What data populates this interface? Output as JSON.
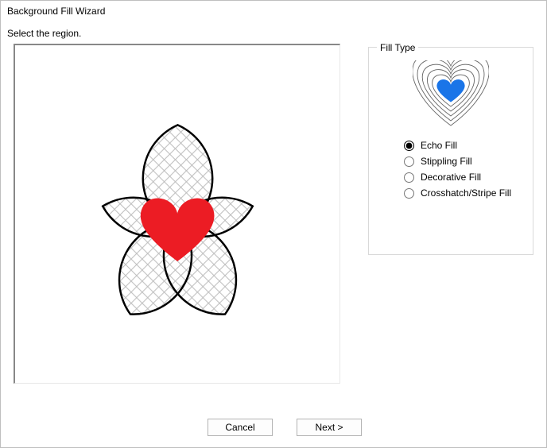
{
  "window": {
    "title": "Background Fill Wizard",
    "instruction": "Select the region."
  },
  "fill_type": {
    "legend": "Fill Type",
    "selected": "echo",
    "options": [
      {
        "id": "echo",
        "label": "Echo Fill"
      },
      {
        "id": "stippling",
        "label": "Stippling Fill"
      },
      {
        "id": "decorative",
        "label": "Decorative Fill"
      },
      {
        "id": "crosshatch",
        "label": "Crosshatch/Stripe Fill"
      }
    ]
  },
  "buttons": {
    "cancel": "Cancel",
    "next": "Next >"
  },
  "preview": {
    "shape": "flower-5-petal-outline",
    "region_fill": "crosshatch-grey",
    "foreground": {
      "shape": "heart",
      "color": "#ec1c24"
    }
  },
  "thumbnail": {
    "style": "echo-contours",
    "center": {
      "shape": "heart",
      "color": "#1a75e8"
    },
    "stroke": "#555"
  }
}
